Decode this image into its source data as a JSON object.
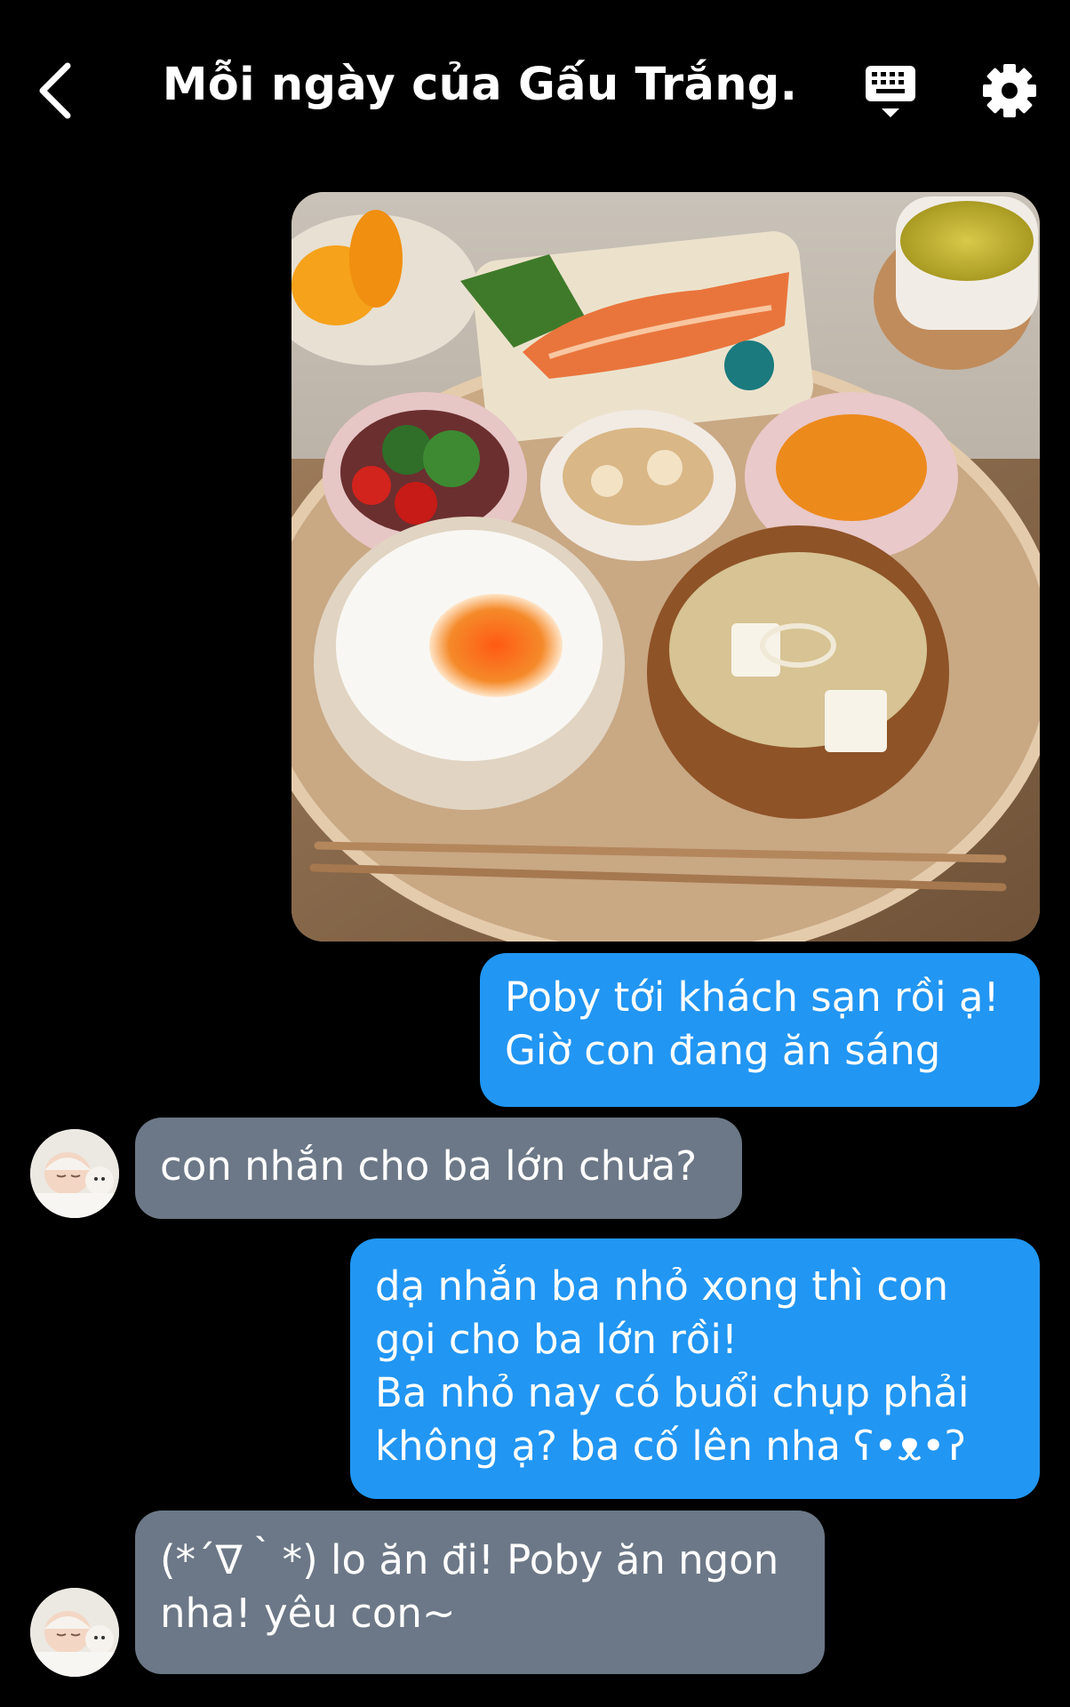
{
  "header": {
    "title": "Mỗi ngày của Gấu Trắng.",
    "back_icon": "chevron-left-icon",
    "keyboard_icon": "keyboard-icon",
    "settings_icon": "gear-icon"
  },
  "colors": {
    "background": "#000000",
    "outgoing_bubble": "#2196f3",
    "incoming_bubble": "#6c7887",
    "text": "#ffffff"
  },
  "messages": [
    {
      "direction": "outgoing",
      "type": "image",
      "image": "photo-japanese-breakfast-tray"
    },
    {
      "direction": "outgoing",
      "type": "text",
      "text": "Poby tới khách sạn rồi ạ!\nGiờ con đang ăn sáng"
    },
    {
      "direction": "incoming",
      "type": "text",
      "text": "con nhắn cho ba lớn chưa?",
      "avatar": "sleeping-baby-avatar"
    },
    {
      "direction": "outgoing",
      "type": "text",
      "text": "dạ nhắn ba nhỏ xong thì con\ngọi cho ba lớn rồi!\nBa nhỏ nay có buổi chụp phải\nkhông ạ? ba cố lên nha ʕ•ᴥ•ʔ"
    },
    {
      "direction": "incoming",
      "type": "text",
      "text": "(*´∇｀*) lo ăn đi! Poby ăn ngon\nnha! yêu con~",
      "avatar": "sleeping-baby-avatar"
    }
  ]
}
